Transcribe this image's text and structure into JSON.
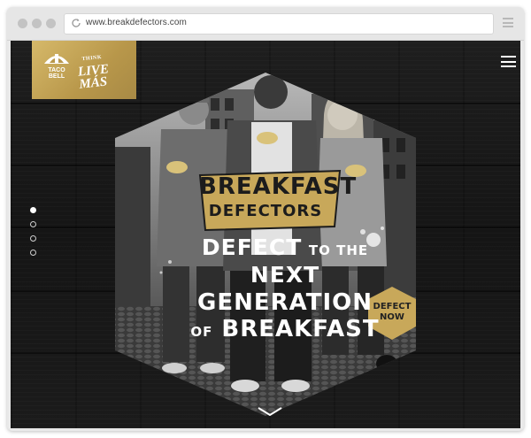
{
  "browser": {
    "url": "www.breakdefectors.com"
  },
  "site": {
    "logo": {
      "brand_line1": "TACO",
      "brand_line2": "BELL",
      "tagline_small": "THINK",
      "tagline_main1": "LIVE",
      "tagline_main2": "MÁS"
    },
    "menu_icon": "hamburger-icon",
    "pager": {
      "count": 4,
      "active_index": 0
    },
    "badge": {
      "line1": "BREAKFAST",
      "line2": "DEFECTORS"
    },
    "headline": {
      "part1": "DEFECT",
      "part2": "TO THE",
      "part3": "NEXT",
      "line2": "GENERATION",
      "part4": "OF",
      "part5": "BREAKFAST"
    },
    "cta": {
      "line1": "DEFECT",
      "line2": "NOW"
    },
    "scroll_icon": "chevron-down-icon"
  },
  "colors": {
    "gold": "#c8a85a",
    "background": "#1a1a1a",
    "frame": "#e6e6e6"
  }
}
